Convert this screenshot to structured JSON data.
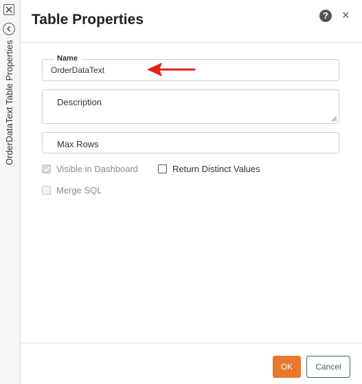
{
  "rail": {
    "label": "OrderDataText Table Properties",
    "close_icon": "close-box-icon",
    "back_icon": "chevron-left-circle-icon"
  },
  "header": {
    "title": "Table Properties",
    "help_glyph": "?",
    "close_glyph": "×"
  },
  "form": {
    "name_label": "Name",
    "name_value": "OrderDataText",
    "description_placeholder": "Description",
    "max_rows_placeholder": "Max Rows",
    "visible_in_dashboard": {
      "label": "Visible in Dashboard",
      "checked": true,
      "disabled": true
    },
    "return_distinct_values": {
      "label": "Return Distinct Values",
      "checked": false,
      "disabled": false
    },
    "merge_sql": {
      "label": "Merge SQL",
      "checked": false,
      "disabled": true
    }
  },
  "footer": {
    "ok_label": "OK",
    "cancel_label": "Cancel"
  },
  "colors": {
    "accent": "#e8782b",
    "secondary": "#2d6b66",
    "annotation_arrow": "#e0201b"
  }
}
